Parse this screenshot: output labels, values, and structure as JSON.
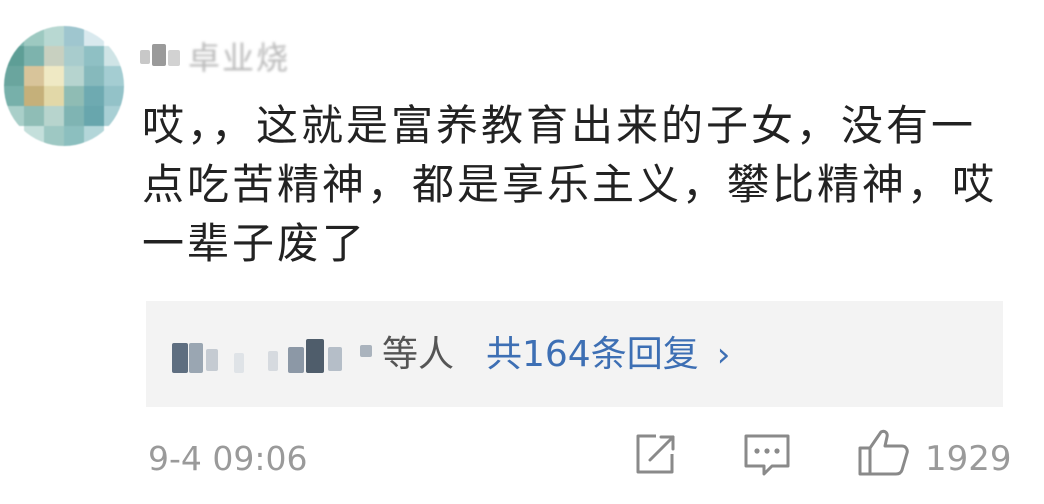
{
  "comment": {
    "username": "卓业烧",
    "text": "哎，，这就是富养教育出来的子女，没有一点吃苦精神，都是享乐主义，攀比精神，哎一辈子废了",
    "timestamp": "9-4 09:06",
    "like_count": "1929"
  },
  "replies": {
    "others_label": "等人",
    "link_label": "共164条回复",
    "chevron": "›"
  },
  "icons": {
    "share": "share-icon",
    "comment": "comment-icon",
    "like": "like-icon",
    "color": "#8a8a8a"
  },
  "colors": {
    "link": "#3d6fb4",
    "reply_bg": "#f3f3f3",
    "meta_text": "#9a9a9a"
  }
}
